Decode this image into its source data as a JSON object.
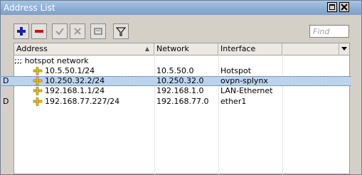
{
  "window": {
    "title": "Address List"
  },
  "toolbar": {
    "buttons": [
      {
        "name": "add-button",
        "icon": "plus-icon"
      },
      {
        "name": "remove-button",
        "icon": "minus-icon"
      },
      {
        "name": "enable-button",
        "icon": "check-icon"
      },
      {
        "name": "disable-button",
        "icon": "x-icon"
      },
      {
        "name": "comment-button",
        "icon": "note-icon"
      },
      {
        "name": "filter-button",
        "icon": "funnel-icon"
      }
    ],
    "find_placeholder": "Find"
  },
  "table": {
    "columns": [
      "Address",
      "Network",
      "Interface"
    ],
    "comment": ";;; hotspot network",
    "rows": [
      {
        "flag": "",
        "address": "10.5.50.1/24",
        "network": "10.5.50.0",
        "interface": "Hotspot",
        "selected": false
      },
      {
        "flag": "D",
        "address": "10.250.32.2/24",
        "network": "10.250.32.0",
        "interface": "ovpn-splynx",
        "selected": true
      },
      {
        "flag": "",
        "address": "192.168.1.1/24",
        "network": "192.168.1.0",
        "interface": "LAN-Ethernet",
        "selected": false
      },
      {
        "flag": "D",
        "address": "192.168.77.227/24",
        "network": "192.168.77.0",
        "interface": "ether1",
        "selected": false
      }
    ]
  },
  "colors": {
    "titlebar": "#8fb0d6",
    "selection": "#bcd3ee",
    "address_icon": "#e8c020"
  }
}
